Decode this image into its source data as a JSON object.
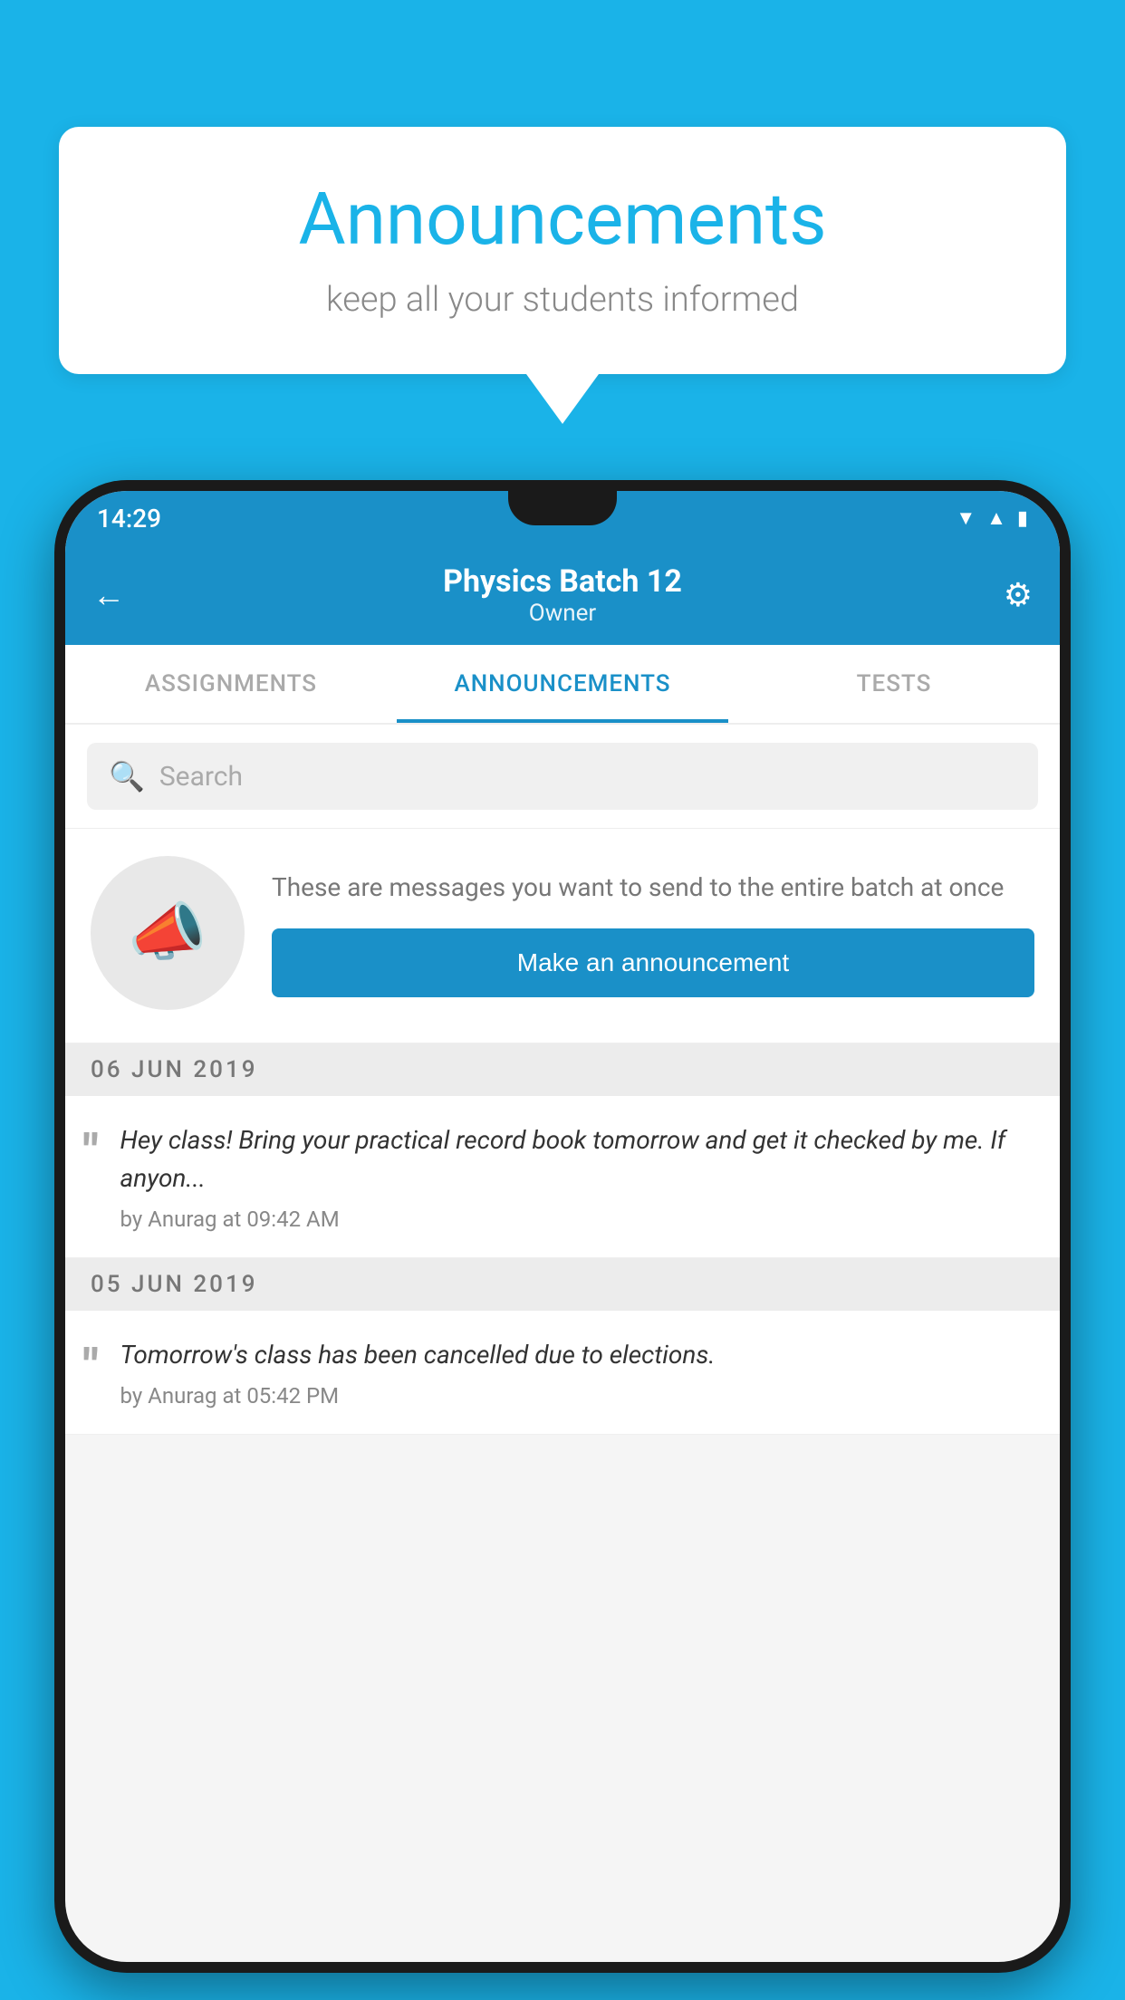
{
  "background_color": "#1ab3e8",
  "speech_bubble": {
    "title": "Announcements",
    "subtitle": "keep all your students informed"
  },
  "phone": {
    "status_bar": {
      "time": "14:29",
      "icons": [
        "wifi",
        "signal",
        "battery"
      ]
    },
    "app_bar": {
      "title": "Physics Batch 12",
      "subtitle": "Owner",
      "back_label": "←",
      "gear_label": "⚙"
    },
    "tabs": [
      {
        "label": "ASSIGNMENTS",
        "active": false
      },
      {
        "label": "ANNOUNCEMENTS",
        "active": true
      },
      {
        "label": "TESTS",
        "active": false
      }
    ],
    "search": {
      "placeholder": "Search"
    },
    "promo": {
      "description": "These are messages you want to send to the entire batch at once",
      "button_label": "Make an announcement"
    },
    "announcements": [
      {
        "date": "06  JUN  2019",
        "items": [
          {
            "text": "Hey class! Bring your practical record book tomorrow and get it checked by me. If anyon...",
            "author": "by Anurag at 09:42 AM"
          }
        ]
      },
      {
        "date": "05  JUN  2019",
        "items": [
          {
            "text": "Tomorrow's class has been cancelled due to elections.",
            "author": "by Anurag at 05:42 PM"
          }
        ]
      }
    ]
  }
}
